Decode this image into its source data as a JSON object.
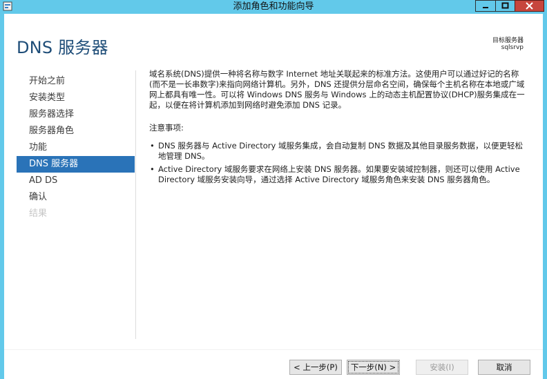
{
  "window": {
    "title": "添加角色和功能向导"
  },
  "header": {
    "title": "DNS 服务器",
    "target_label": "目标服务器",
    "target_value": "sqlsrvp"
  },
  "nav": {
    "items": [
      {
        "label": "开始之前",
        "state": "normal"
      },
      {
        "label": "安装类型",
        "state": "normal"
      },
      {
        "label": "服务器选择",
        "state": "normal"
      },
      {
        "label": "服务器角色",
        "state": "normal"
      },
      {
        "label": "功能",
        "state": "normal"
      },
      {
        "label": "DNS 服务器",
        "state": "active"
      },
      {
        "label": "AD DS",
        "state": "normal"
      },
      {
        "label": "确认",
        "state": "normal"
      },
      {
        "label": "结果",
        "state": "disabled"
      }
    ]
  },
  "content": {
    "intro": "域名系统(DNS)提供一种将名称与数字 Internet 地址关联起来的标准方法。这使用户可以通过好记的名称(而不是一长串数字)来指向网络计算机。另外，DNS 还提供分层命名空间，确保每个主机名称在本地或广域网上都具有唯一性。可以将 Windows DNS 服务与 Windows 上的动态主机配置协议(DHCP)服务集成在一起，以便在将计算机添加到网络时避免添加 DNS 记录。",
    "notes_title": "注意事项:",
    "notes": [
      "DNS 服务器与 Active Directory 域服务集成，会自动复制 DNS 数据及其他目录服务数据，以便更轻松地管理 DNS。",
      "Active Directory 域服务要求在网络上安装 DNS 服务器。如果要安装域控制器，则还可以使用 Active Directory 域服务安装向导，通过选择 Active Directory 域服务角色来安装 DNS 服务器角色。"
    ]
  },
  "buttons": {
    "prev": "< 上一步(P)",
    "next": "下一步(N) >",
    "install": "安装(I)",
    "cancel": "取消"
  },
  "colors": {
    "frame": "#62c9ea",
    "accent": "#2a73b8",
    "title_text": "#1e4d78"
  }
}
